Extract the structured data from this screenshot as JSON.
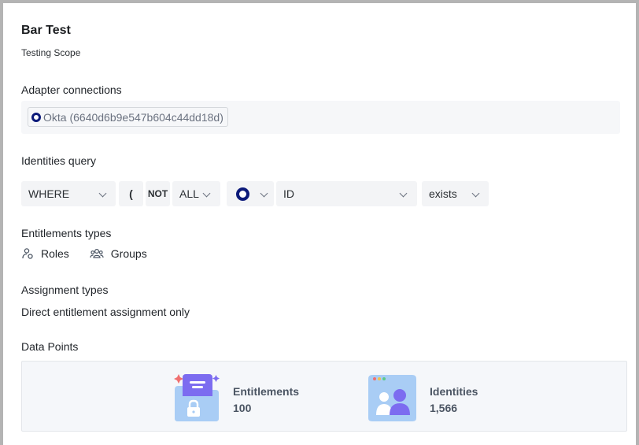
{
  "scope": {
    "title": "Bar Test",
    "subtitle": "Testing Scope"
  },
  "adapter_connections": {
    "label": "Adapter connections",
    "chips": [
      {
        "label": "Okta (6640d6b9e547b604c44dd18d)",
        "icon": "okta-icon"
      }
    ]
  },
  "identities_query": {
    "label": "Identities query",
    "where": "WHERE",
    "open_paren": "(",
    "not": "NOT",
    "all": "ALL",
    "adapter_icon": "okta-icon",
    "field": "ID",
    "operator": "exists"
  },
  "entitlement_types": {
    "label": "Entitlements types",
    "items": [
      {
        "label": "Roles",
        "icon": "roles-icon"
      },
      {
        "label": "Groups",
        "icon": "groups-icon"
      }
    ]
  },
  "assignment_types": {
    "label": "Assignment types",
    "value": "Direct entitlement assignment only"
  },
  "data_points": {
    "label": "Data Points",
    "items": [
      {
        "label": "Entitlements",
        "value": "100",
        "icon": "entitlements-folder-icon"
      },
      {
        "label": "Identities",
        "value": "1,566",
        "icon": "identities-folder-icon"
      }
    ]
  },
  "colors": {
    "okta_blue": "#0c1a7a",
    "folder_blue": "#a9cdf5",
    "accent_purple": "#7c6cf0"
  }
}
